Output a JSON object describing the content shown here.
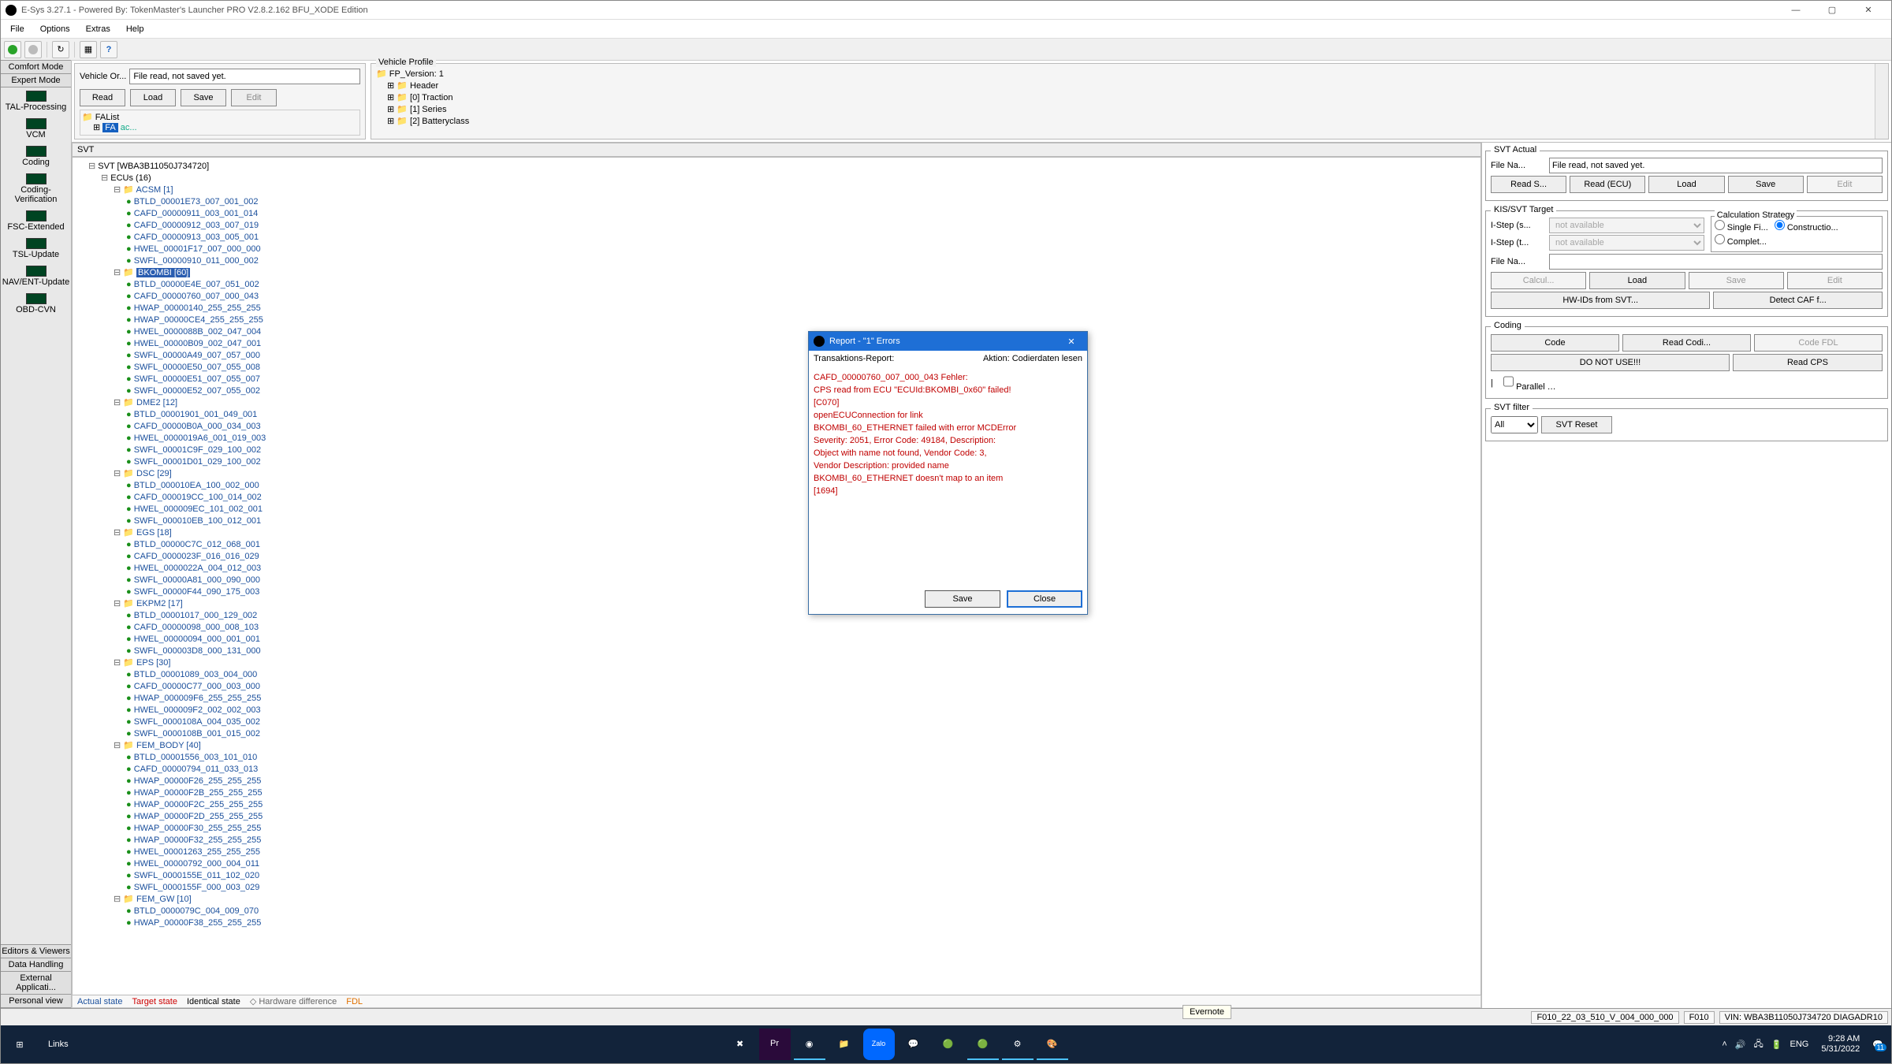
{
  "title": "E-Sys 3.27.1 - Powered By: TokenMaster's Launcher PRO V2.8.2.162 BFU_XODE Edition",
  "menu": {
    "file": "File",
    "options": "Options",
    "extras": "Extras",
    "help": "Help"
  },
  "leftnav": {
    "comfort": "Comfort Mode",
    "expert": "Expert Mode",
    "items": [
      "TAL-Processing",
      "VCM",
      "Coding",
      "Coding-Verification",
      "FSC-Extended",
      "TSL-Update",
      "NAV/ENT-Update",
      "OBD-CVN"
    ],
    "editors": "Editors & Viewers",
    "data": "Data Handling",
    "external": "External Applicati...",
    "personal": "Personal view"
  },
  "vehicleOrder": {
    "label": "Vehicle Or...",
    "filename": "File read, not saved yet.",
    "read": "Read",
    "load": "Load",
    "save": "Save",
    "edit": "Edit",
    "tree_root": "FAList",
    "tree_child": "FA",
    "tree_child_suffix": "ac..."
  },
  "vehicleProfile": {
    "label": "Vehicle Profile",
    "lines": [
      "FP_Version: 1",
      "Header",
      "[0] Traction",
      "[1] Series",
      "[2] Batteryclass"
    ]
  },
  "svt": {
    "header": "SVT",
    "root": "SVT [WBA3B11050J734720]",
    "ecus": "ECUs (16)",
    "groups": [
      {
        "name": "ACSM [1]",
        "files": [
          "BTLD_00001E73_007_001_002",
          "CAFD_00000911_003_001_014",
          "CAFD_00000912_003_007_019",
          "CAFD_00000913_003_005_001",
          "HWEL_00001F17_007_000_000",
          "SWFL_00000910_011_000_002"
        ]
      },
      {
        "name": "BKOMBI [60]",
        "highlight": true,
        "files": [
          "BTLD_00000E4E_007_051_002",
          "CAFD_00000760_007_000_043",
          "HWAP_00000140_255_255_255",
          "HWAP_00000CE4_255_255_255",
          "HWEL_0000088B_002_047_004",
          "HWEL_00000B09_002_047_001",
          "SWFL_00000A49_007_057_000",
          "SWFL_00000E50_007_055_008",
          "SWFL_00000E51_007_055_007",
          "SWFL_00000E52_007_055_002"
        ]
      },
      {
        "name": "DME2 [12]",
        "files": [
          "BTLD_00001901_001_049_001",
          "CAFD_00000B0A_000_034_003",
          "HWEL_0000019A6_001_019_003",
          "SWFL_00001C9F_029_100_002",
          "SWFL_00001D01_029_100_002"
        ]
      },
      {
        "name": "DSC [29]",
        "files": [
          "BTLD_000010EA_100_002_000",
          "CAFD_000019CC_100_014_002",
          "HWEL_000009EC_101_002_001",
          "SWFL_000010EB_100_012_001"
        ]
      },
      {
        "name": "EGS [18]",
        "files": [
          "BTLD_00000C7C_012_068_001",
          "CAFD_0000023F_016_016_029",
          "HWEL_0000022A_004_012_003",
          "SWFL_00000A81_000_090_000",
          "SWFL_00000F44_090_175_003"
        ]
      },
      {
        "name": "EKPM2 [17]",
        "files": [
          "BTLD_00001017_000_129_002",
          "CAFD_00000098_000_008_103",
          "HWEL_00000094_000_001_001",
          "SWFL_000003D8_000_131_000"
        ]
      },
      {
        "name": "EPS [30]",
        "files": [
          "BTLD_00001089_003_004_000",
          "CAFD_00000C77_000_003_000",
          "HWAP_000009F6_255_255_255",
          "HWEL_000009F2_002_002_003",
          "SWFL_0000108A_004_035_002",
          "SWFL_0000108B_001_015_002"
        ]
      },
      {
        "name": "FEM_BODY [40]",
        "files": [
          "BTLD_00001556_003_101_010",
          "CAFD_00000794_011_033_013",
          "HWAP_00000F26_255_255_255",
          "HWAP_00000F2B_255_255_255",
          "HWAP_00000F2C_255_255_255",
          "HWAP_00000F2D_255_255_255",
          "HWAP_00000F30_255_255_255",
          "HWAP_00000F32_255_255_255",
          "HWEL_00001263_255_255_255",
          "HWEL_00000792_000_004_011",
          "SWFL_0000155E_011_102_020",
          "SWFL_0000155F_000_003_029"
        ]
      },
      {
        "name": "FEM_GW [10]",
        "files": [
          "BTLD_0000079C_004_009_070",
          "HWAP_00000F38_255_255_255"
        ]
      }
    ],
    "legend": {
      "actual": "Actual state",
      "target": "Target state",
      "identical": "Identical state",
      "hw": "Hardware difference",
      "fdl": "FDL"
    }
  },
  "right": {
    "svtActual": {
      "legend": "SVT Actual",
      "fileLabel": "File Na...",
      "file": "File read, not saved yet.",
      "readSvt": "Read S...",
      "readEcu": "Read (ECU)",
      "load": "Load",
      "save": "Save",
      "edit": "Edit"
    },
    "kisSvt": {
      "legend": "KIS/SVT Target",
      "istepShip": "I-Step (s...",
      "istepTarget": "I-Step (t...",
      "na": "not available",
      "calcLegend": "Calculation Strategy",
      "single": "Single Fi...",
      "construct": "Constructio...",
      "complete": "Complet...",
      "fileLabel": "File Na...",
      "calc": "Calcul...",
      "load": "Load",
      "save": "Save",
      "edit": "Edit",
      "hwid": "HW-IDs from SVT...",
      "detect": "Detect CAF f..."
    },
    "coding": {
      "legend": "Coding",
      "code": "Code",
      "readCoding": "Read Codi...",
      "codeFdl": "Code FDL",
      "doNotUse": "DO NOT USE!!!",
      "readCps": "Read CPS",
      "parallel": "Parallel TAL-Exec..."
    },
    "svtFilter": {
      "legend": "SVT filter",
      "all": "All",
      "reset": "SVT Reset"
    }
  },
  "dialog": {
    "title": "Report - \"1\" Errors",
    "trans": "Transaktions-Report:",
    "action": "Aktion: Codierdaten lesen",
    "body": "CAFD_00000760_007_000_043 Fehler:\nCPS read from ECU \"ECUId:BKOMBI_0x60\" failed!\n[C070]\nopenECUConnection for link\nBKOMBI_60_ETHERNET failed with error MCDError\nSeverity: 2051, Error Code: 49184, Description:\nObject with name not found, Vendor Code: 3,\nVendor Description: provided name\nBKOMBI_60_ETHERNET doesn't map to an item\n[1694]",
    "save": "Save",
    "close": "Close"
  },
  "status": {
    "istep": "F010_22_03_510_V_004_000_000",
    "series": "F010",
    "vin": "VIN: WBA3B11050J734720  DIAGADR10"
  },
  "tooltip": "Evernote",
  "taskbar": {
    "links": "Links",
    "lang": "ENG",
    "time": "9:28 AM",
    "date": "5/31/2022",
    "notif": "11"
  }
}
